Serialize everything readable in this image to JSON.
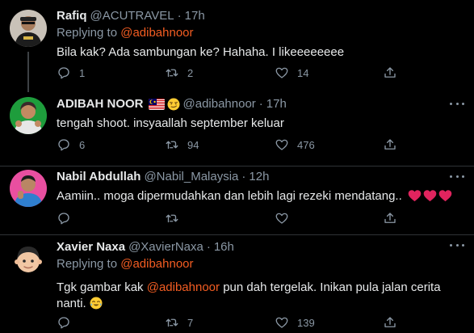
{
  "tweets": [
    {
      "name": "Rafiq",
      "handle": "@ACUTRAVEL",
      "separator": "·",
      "time": "17h",
      "replying_prefix": "Replying to",
      "replying_to": "@adibahnoor",
      "text": "Bila kak? Ada sambungan ke? Hahaha. I likeeeeeeee",
      "replies": "1",
      "retweets": "2",
      "likes": "14"
    },
    {
      "name": "ADIBAH NOOR",
      "handle": "@adibahnoor",
      "separator": "·",
      "time": "17h",
      "text": "tengah shoot. insyaallah september keluar",
      "replies": "6",
      "retweets": "94",
      "likes": "476"
    },
    {
      "name": "Nabil Abdullah",
      "handle": "@Nabil_Malaysia",
      "separator": "·",
      "time": "12h",
      "text": "Aamiin.. moga dipermudahkan dan lebih lagi rezeki mendatang..",
      "replies": "",
      "retweets": "",
      "likes": ""
    },
    {
      "name": "Xavier Naxa",
      "handle": "@XavierNaxa",
      "separator": "·",
      "time": "16h",
      "replying_prefix": "Replying to",
      "replying_to": "@adibahnoor",
      "text_before": "Tgk gambar kak",
      "text_mention": "@adibahnoor",
      "text_after": "pun dah tergelak. Inikan pula jalan cerita",
      "text_line2": "nanti.",
      "replies": "",
      "retweets": "7",
      "likes": "139"
    }
  ],
  "colors": {
    "background": "#000000",
    "mention": "#f45d22",
    "secondary": "#8b98a5",
    "divider": "#2f3336",
    "heart": "#e0245e"
  }
}
